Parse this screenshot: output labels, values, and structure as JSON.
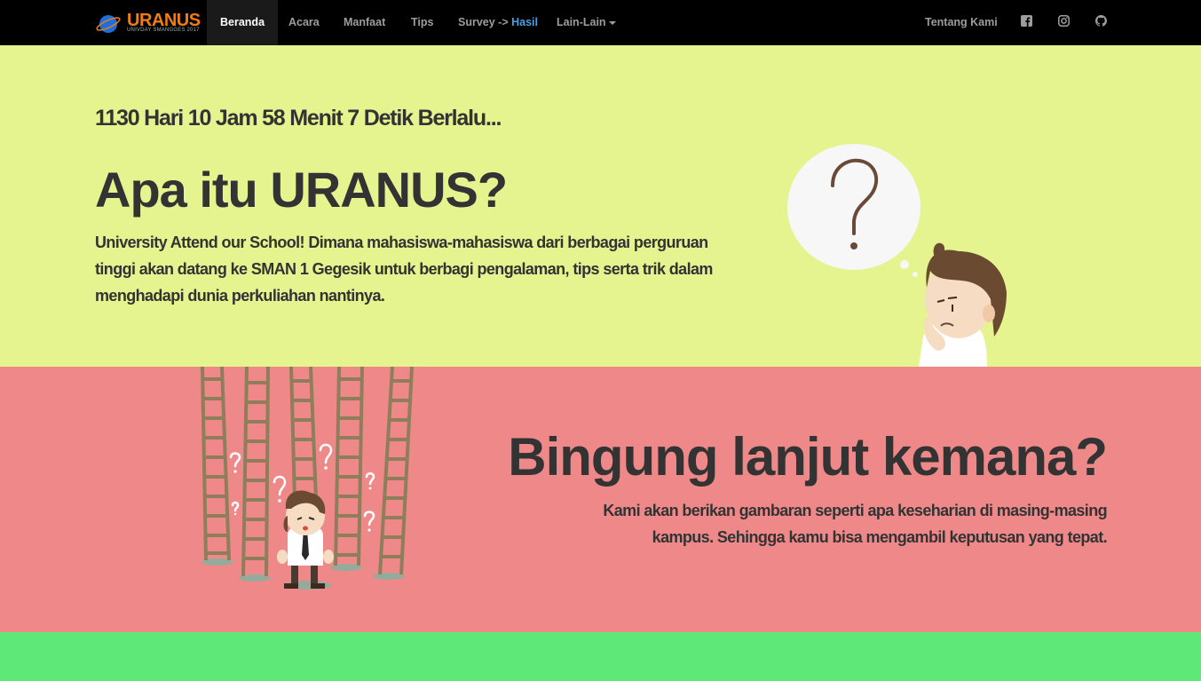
{
  "brand": {
    "title": "URANUS",
    "subtitle": "UNIVDAY SMANGGES 2017",
    "accent": "#f07d14"
  },
  "nav": {
    "items": [
      {
        "label": "Beranda",
        "active": true
      },
      {
        "label": "Acara"
      },
      {
        "label": "Manfaat"
      },
      {
        "label": "Tips"
      },
      {
        "label_prefix": "Survey -> ",
        "label_highlight": "Hasil"
      },
      {
        "label": "Lain-Lain",
        "dropdown": true
      }
    ],
    "right": {
      "about": "Tentang Kami",
      "icons": [
        "facebook-icon",
        "instagram-icon",
        "github-icon"
      ]
    }
  },
  "hero": {
    "countdown": "1130 Hari 10 Jam 58 Menit 7 Detik Berlalu...",
    "title": "Apa itu URANUS?",
    "description": "University Attend our School! Dimana mahasiswa-mahasiswa dari berbagai perguruan tinggi akan datang ke SMAN 1 Gegesik untuk berbagi pengalaman, tips serta trik dalam menghadapi dunia perkuliahan nantinya.",
    "bg": "#e5f48f"
  },
  "section2": {
    "title": "Bingung lanjut kemana?",
    "description": "Kami akan berikan gambaran seperti apa keseharian di masing-masing kampus. Sehingga kamu bisa mengambil keputusan yang tepat.",
    "bg": "#ef8989"
  },
  "section3": {
    "bg": "#5de877"
  }
}
